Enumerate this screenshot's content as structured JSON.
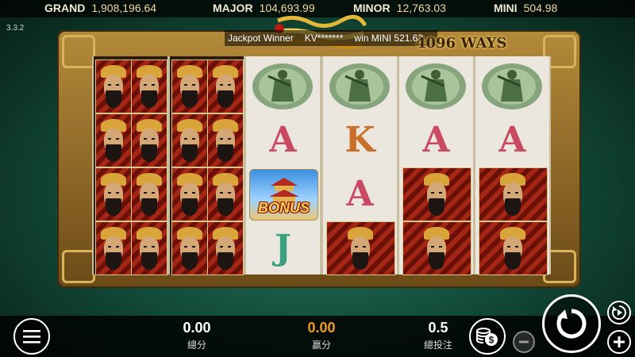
{
  "jackpots": [
    {
      "label": "GRAND",
      "value": "1,908,196.64"
    },
    {
      "label": "MAJOR",
      "value": "104,693.99"
    },
    {
      "label": "MINOR",
      "value": "12,763.03"
    },
    {
      "label": "MINI",
      "value": "504.98"
    }
  ],
  "version": "3.3.2",
  "ticker": {
    "prefix": "Jackpot Winner",
    "player": "KV*******",
    "message": "win MINI 521.63"
  },
  "ways_label": "4096 WAYS",
  "reels": [
    [
      "emperor",
      "emperor",
      "emperor",
      "emperor"
    ],
    [
      "emperor",
      "emperor",
      "emperor",
      "emperor"
    ],
    [
      "soldier",
      "A",
      "bonus",
      "J"
    ],
    [
      "soldier",
      "K",
      "A",
      "emperor"
    ],
    [
      "soldier",
      "A",
      "emperor",
      "emperor"
    ],
    [
      "soldier",
      "A",
      "emperor",
      "emperor"
    ]
  ],
  "symbols": {
    "bonus_text": "BONUS",
    "letter_colors": {
      "A": "#c94a62",
      "K": "#c8702a",
      "J": "#3aa07e"
    }
  },
  "bottom": {
    "total_value": "0.00",
    "total_label": "總分",
    "win_value": "0.00",
    "win_label": "贏分",
    "bet_value": "0.5",
    "bet_label": "總投注"
  },
  "colors": {
    "accent_orange": "#f39a1e",
    "jackpot_value": "#f3d9a0"
  },
  "icons": {
    "menu": "hamburger-icon",
    "coins": "coins-icon",
    "minus": "minus-icon",
    "spin": "spin-icon",
    "autoplay": "autoplay-icon",
    "plus": "plus-icon"
  }
}
